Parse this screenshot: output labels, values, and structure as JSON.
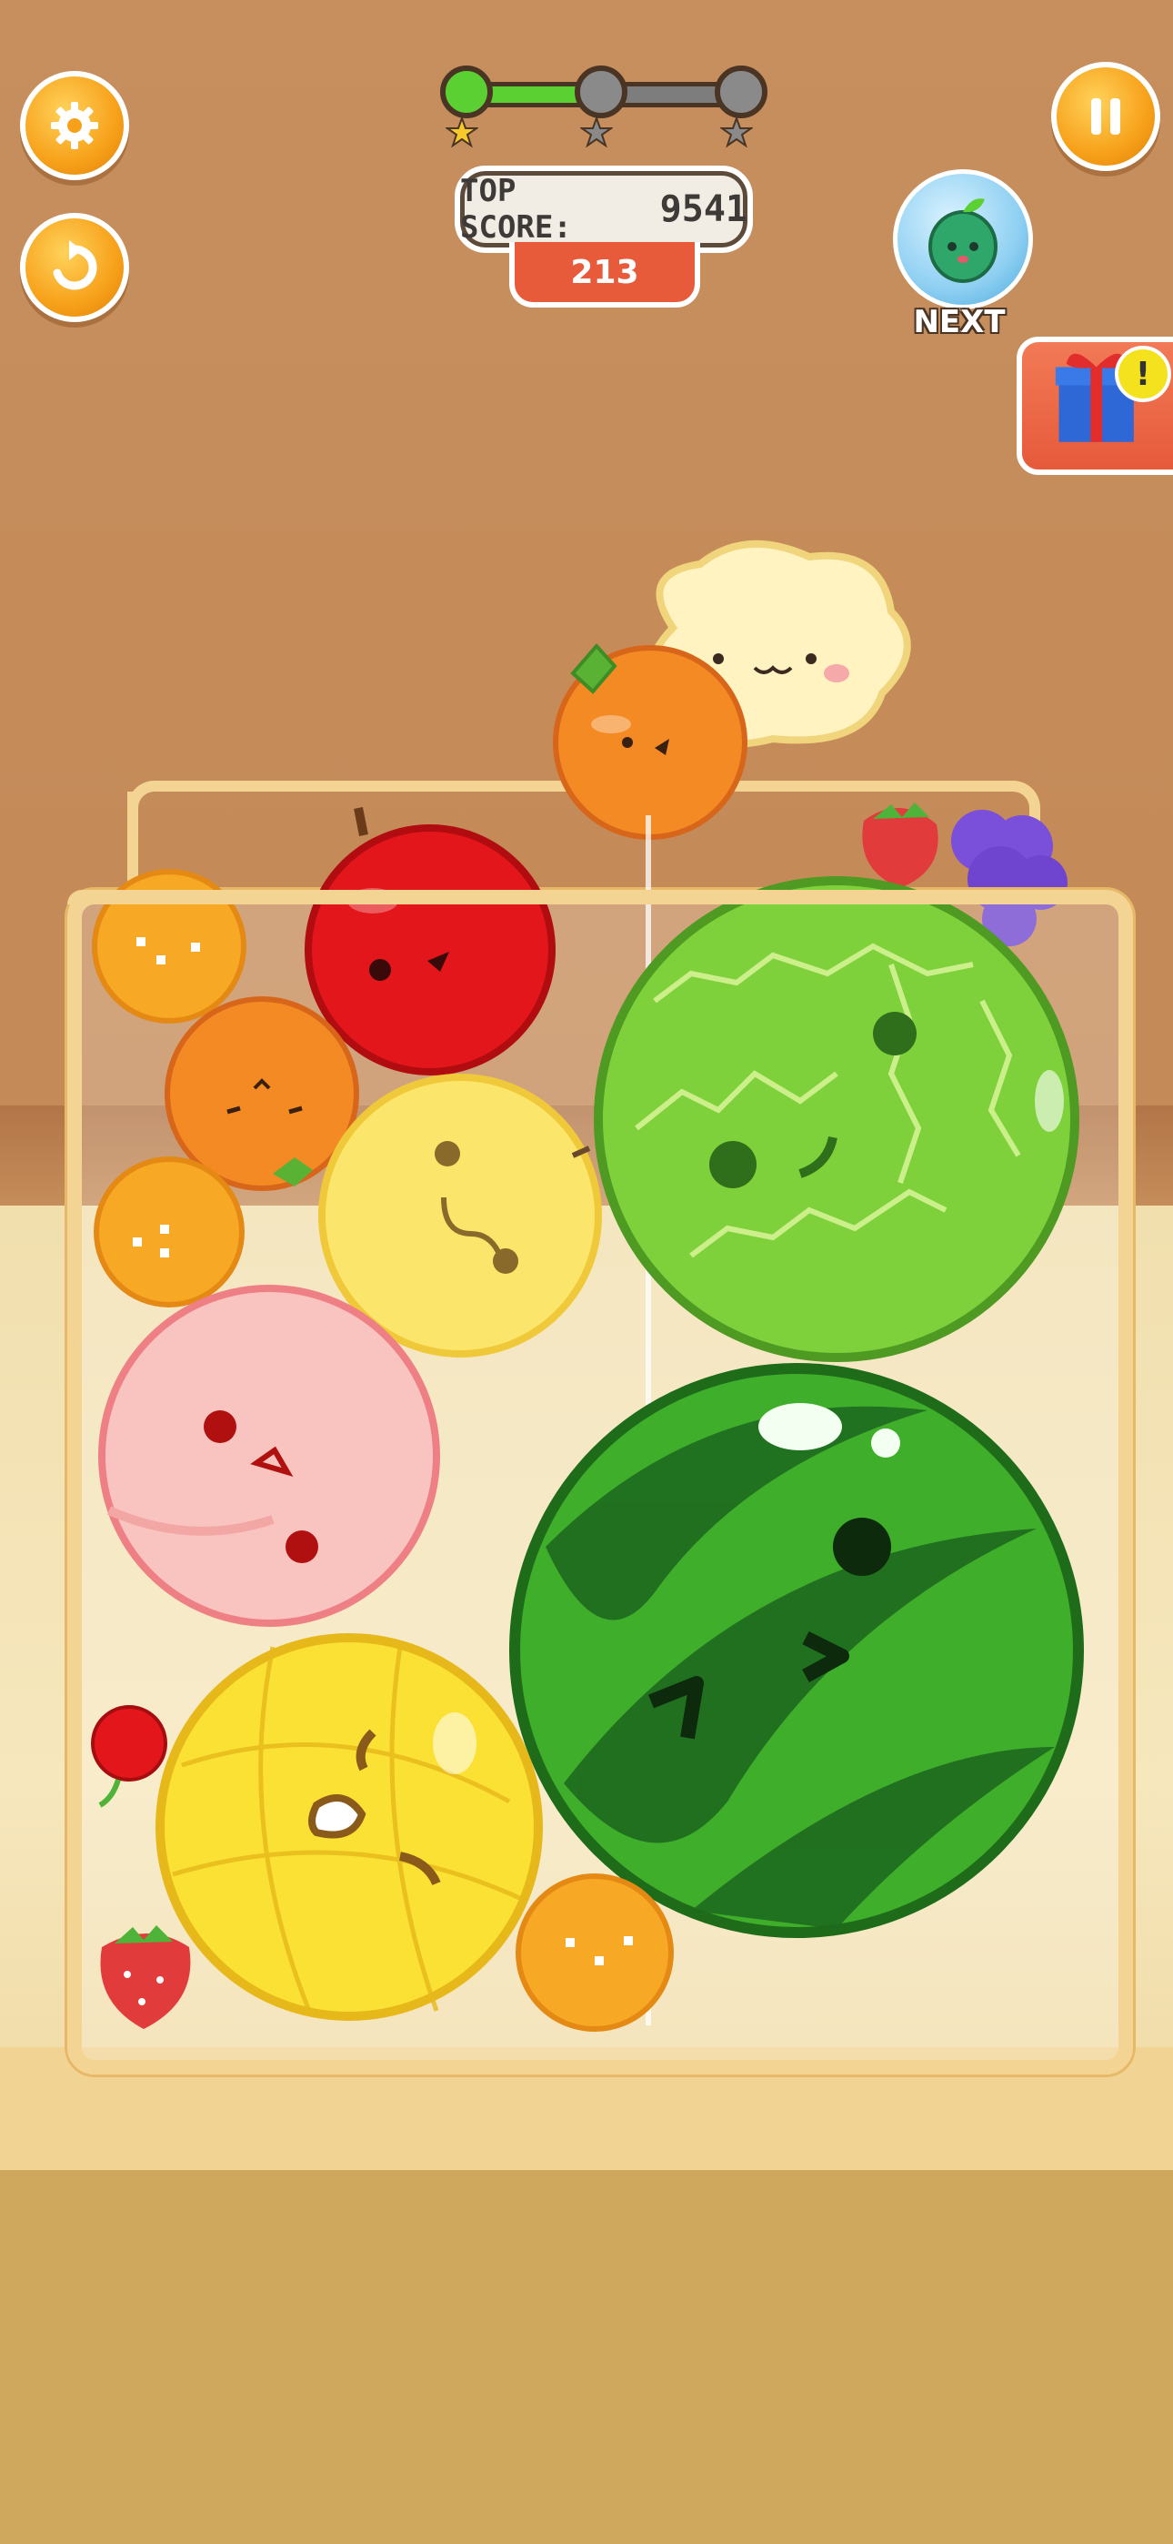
{
  "hud": {
    "settings_icon": "gear-icon",
    "restart_icon": "restart-icon",
    "pause_icon": "pause-icon",
    "top_score_label": "TOP SCORE:",
    "top_score_value": "9541",
    "current_score": "213",
    "next_label": "NEXT",
    "next_fruit": "lime",
    "stage_progress": 0.5,
    "stars_earned": 1,
    "stars_total": 3,
    "gift_icon": "gift-icon",
    "gift_alert": "!"
  },
  "colors": {
    "button_orange": "#f7a11a",
    "progress_green": "#5ad033",
    "score_red": "#e75a3a",
    "box_gold": "#f4d493"
  },
  "fruits": {
    "dropping": [
      "orange"
    ],
    "in_box": [
      "apple",
      "tangerine",
      "tangerine",
      "tangerine",
      "orange",
      "lemon",
      "melon",
      "peach",
      "watermelon",
      "pineapple",
      "cherry",
      "strawberry",
      "strawberry",
      "grape"
    ],
    "behind": [
      "cream puff"
    ]
  }
}
